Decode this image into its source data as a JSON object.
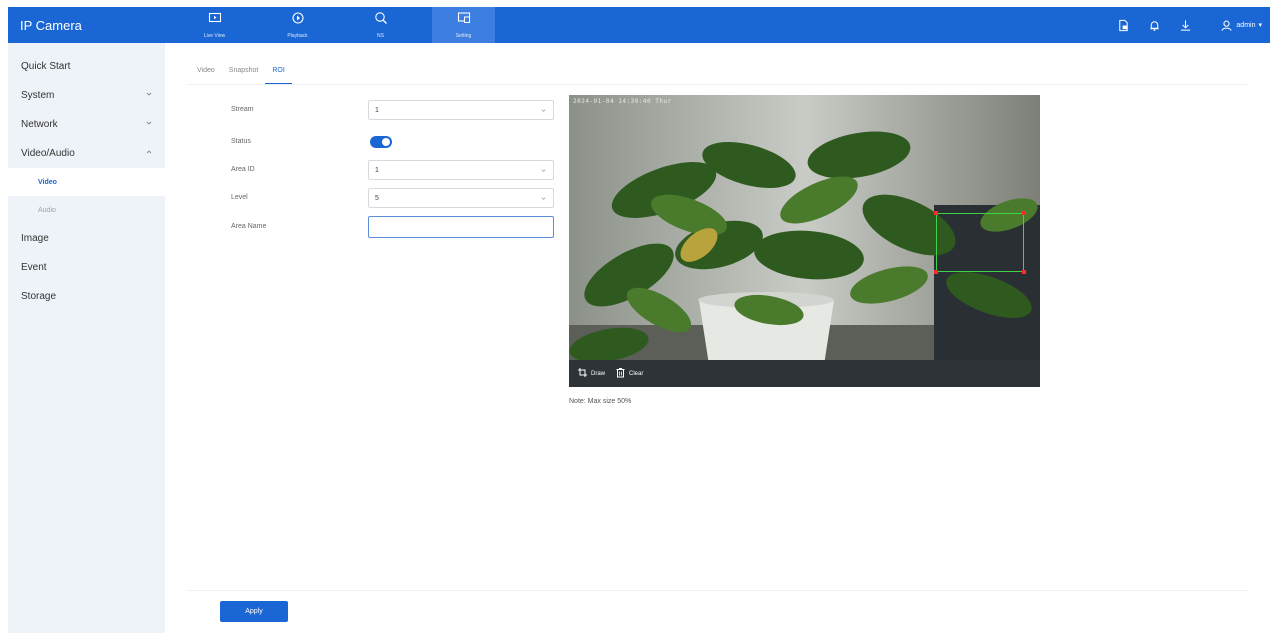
{
  "app": {
    "title": "IP Camera"
  },
  "topnav": [
    {
      "label": "Live View",
      "icon": "live-view-icon"
    },
    {
      "label": "Playback",
      "icon": "playback-icon"
    },
    {
      "label": "NS",
      "icon": "ns-icon"
    },
    {
      "label": "Setting",
      "icon": "setting-icon",
      "active": true
    }
  ],
  "topright": {
    "user": "admin",
    "icons": [
      "file-icon",
      "bell-icon",
      "download-icon",
      "user-icon"
    ]
  },
  "sidebar": {
    "items": [
      {
        "label": "Quick Start"
      },
      {
        "label": "System",
        "expandable": true
      },
      {
        "label": "Network",
        "expandable": true
      },
      {
        "label": "Video/Audio",
        "expanded": true
      },
      {
        "label": "Image"
      },
      {
        "label": "Event"
      },
      {
        "label": "Storage"
      }
    ],
    "subitems": [
      {
        "label": "Video",
        "active": true
      },
      {
        "label": "Audio"
      }
    ]
  },
  "tabs": [
    {
      "label": "Video"
    },
    {
      "label": "Snapshot"
    },
    {
      "label": "ROI",
      "active": true
    }
  ],
  "form": {
    "stream_label": "Stream",
    "stream_value": "1",
    "status_label": "Status",
    "status_on": true,
    "area_id_label": "Area ID",
    "area_id_value": "1",
    "level_label": "Level",
    "level_value": "5",
    "area_name_label": "Area Name",
    "area_name_value": ""
  },
  "video": {
    "osd": "2024-01-04 14:39:40 Thur",
    "draw_label": "Draw",
    "clear_label": "Clear",
    "note": "Note: Max size 50%"
  },
  "actions": {
    "apply_label": "Apply"
  },
  "colors": {
    "primary": "#1a66d4",
    "sidebar_bg": "#eef2f9",
    "roi_border": "#3fd24a",
    "roi_handle": "#ff2a2a"
  }
}
